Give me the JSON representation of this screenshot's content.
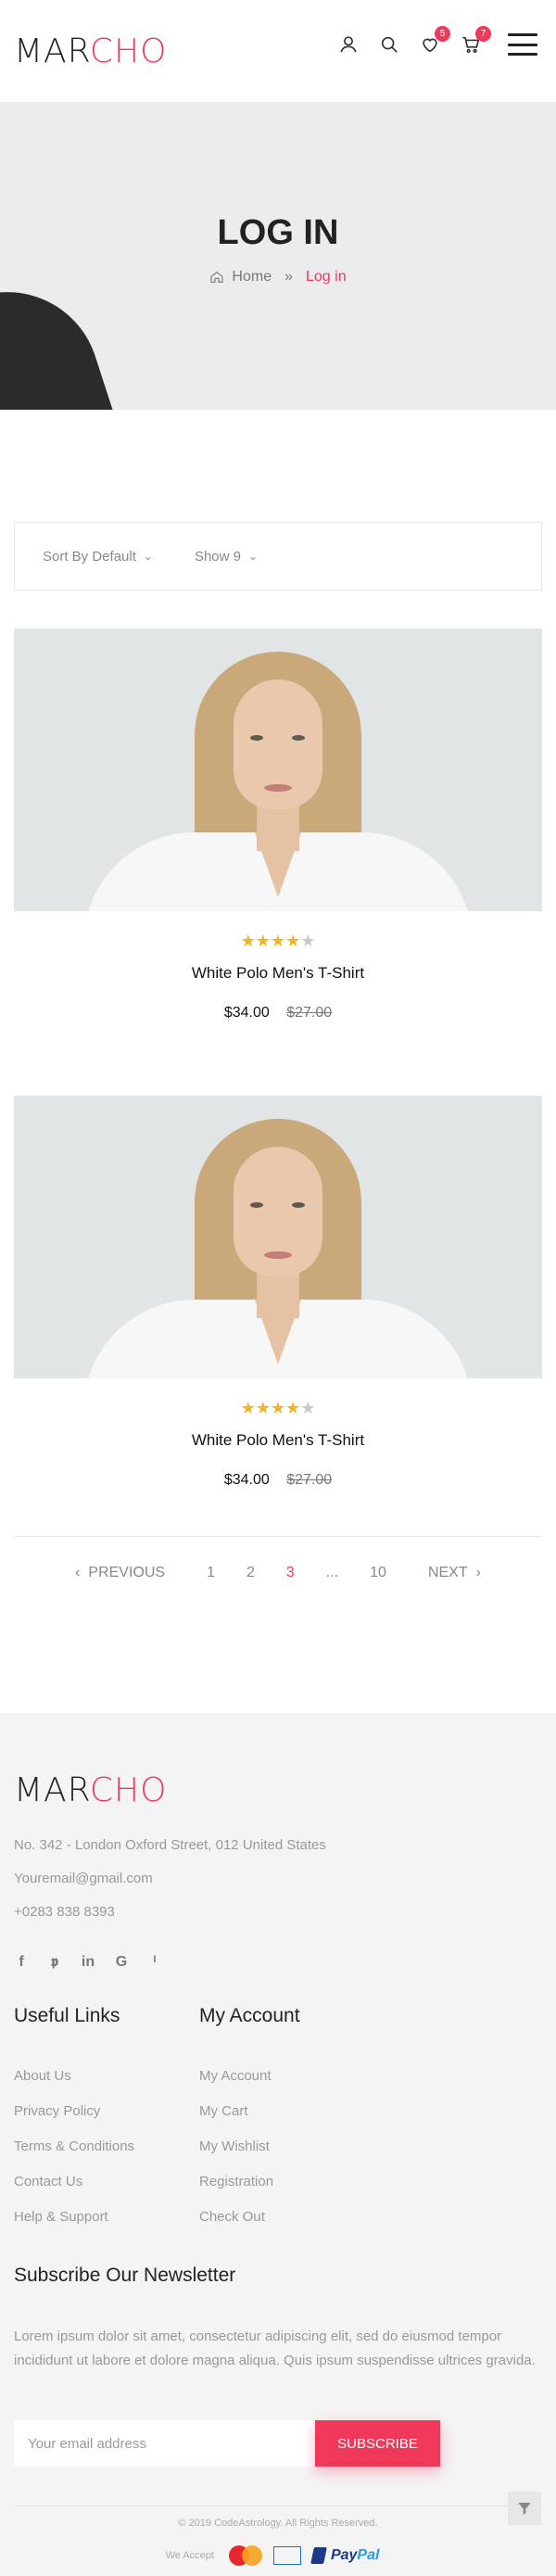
{
  "header": {
    "logo_part1": "MAR",
    "logo_part2": "CHO",
    "wishlist_count": "5",
    "cart_count": "7"
  },
  "banner": {
    "title": "LOG IN",
    "breadcrumb": {
      "home": "Home",
      "separator": "»",
      "current": "Log in"
    }
  },
  "sortbar": {
    "sort_label": "Sort By Default",
    "show_label": "Show 9"
  },
  "products": [
    {
      "name": "White Polo Men's T-Shirt",
      "price": "$34.00",
      "old_price": "$27.00",
      "rating": 4,
      "rating_max": 5
    },
    {
      "name": "White Polo Men's T-Shirt",
      "price": "$34.00",
      "old_price": "$27.00",
      "rating": 4,
      "rating_max": 5
    }
  ],
  "pagination": {
    "previous": "PREVIOUS",
    "pages": [
      "1",
      "2",
      "3",
      "...",
      "10"
    ],
    "active_page": "3",
    "next": "NEXT"
  },
  "footer": {
    "logo_part1": "MAR",
    "logo_part2": "CHO",
    "address": "No. 342 - London Oxford Street, 012 United States",
    "email": "Youremail@gmail.com",
    "phone": "+0283 838 8393",
    "socials": [
      "facebook-icon",
      "twitter-icon",
      "linkedin-icon",
      "google-icon",
      "pinterest-icon"
    ],
    "useful_links": {
      "title": "Useful Links",
      "items": [
        "About Us",
        "Privacy Policy",
        "Terms & Conditions",
        "Contact Us",
        "Help & Support"
      ]
    },
    "my_account": {
      "title": "My Account",
      "items": [
        "My Account",
        "My Cart",
        "My Wishlist",
        "Registration",
        "Check Out"
      ]
    },
    "newsletter": {
      "title": "Subscribe Our Newsletter",
      "text": "Lorem ipsum dolor sit amet, consectetur adipiscing elit, sed do eiusmod tempor incididunt ut labore et dolore magna aliqua. Quis ipsum suspendisse ultrices gravida.",
      "placeholder": "Your email address",
      "button": "SUBSCRIBE"
    },
    "copyright": "© 2019 CodeAstrology. All Rights Reserved.",
    "we_accept": "We Accept",
    "paypal_part1": "Pay",
    "paypal_part2": "Pal"
  },
  "colors": {
    "accent": "#f0385b",
    "star": "#f5b223",
    "footer_bg": "#f4f4f4",
    "banner_bg": "#ececec"
  }
}
